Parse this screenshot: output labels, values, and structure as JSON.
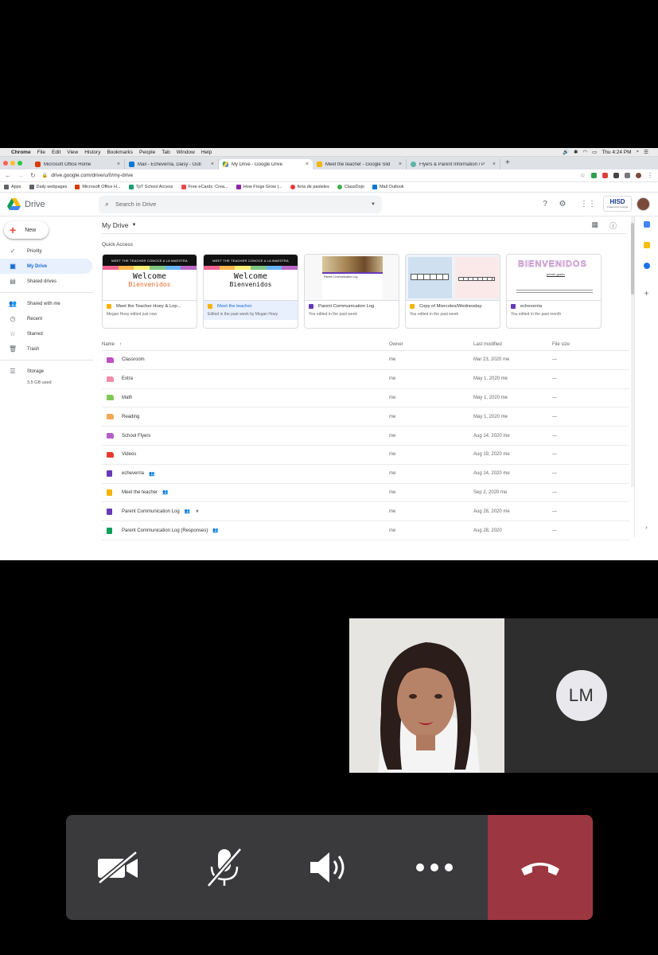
{
  "mac_menu": {
    "items": [
      "Chrome",
      "File",
      "Edit",
      "View",
      "History",
      "Bookmarks",
      "People",
      "Tab",
      "Window",
      "Help"
    ],
    "clock": "Thu 4:24 PM"
  },
  "browser": {
    "tabs": [
      {
        "title": "Microsoft Office Home",
        "color": "#d83b01"
      },
      {
        "title": "Mail - Echeverria, Daisy - Outl",
        "color": "#0078d4"
      },
      {
        "title": "My Drive - Google Drive",
        "color": "#1fa463"
      },
      {
        "title": "Meet the teacher - Google Slid",
        "color": "#f4b400"
      },
      {
        "title": "Flyers & Parent Information / P",
        "color": "#5fb3a6"
      }
    ],
    "url": "drive.google.com/drive/u/0/my-drive",
    "bookmarks": [
      {
        "label": "Apps",
        "color": "#5f6368"
      },
      {
        "label": "Daily webpages",
        "color": "#5f6368"
      },
      {
        "label": "Microsoft Office H...",
        "color": "#d83b01"
      },
      {
        "label": "TpT School Access",
        "color": "#1a9e6e"
      },
      {
        "label": "Free eCards: Crea...",
        "color": "#e94b4b"
      },
      {
        "label": "How Frogs Grow |...",
        "color": "#8e24aa"
      },
      {
        "label": "feria de pasteles",
        "color": "#e53935"
      },
      {
        "label": "ClassDojo",
        "color": "#3fae49"
      },
      {
        "label": "Mail Outlook",
        "color": "#0078d4"
      }
    ]
  },
  "drive": {
    "app_name": "Drive",
    "search_placeholder": "Search in Drive",
    "org_badge": "HISD",
    "org_badge_sub": "Powered by Google",
    "new_label": "New",
    "nav": [
      {
        "label": "Priority",
        "icon": "priority-icon",
        "active": false
      },
      {
        "label": "My Drive",
        "icon": "my-drive-icon",
        "active": true
      },
      {
        "label": "Shared drives",
        "icon": "shared-drives-icon",
        "active": false
      }
    ],
    "nav2": [
      {
        "label": "Shared with me",
        "icon": "shared-with-me-icon"
      },
      {
        "label": "Recent",
        "icon": "clock-icon"
      },
      {
        "label": "Starred",
        "icon": "star-icon"
      },
      {
        "label": "Trash",
        "icon": "trash-icon"
      }
    ],
    "storage_label": "Storage",
    "storage_used": "3.5 GB used",
    "breadcrumb": "My Drive",
    "quick_access_label": "Quick Access",
    "quick_access": [
      {
        "name": "Meet the Teacher Hoey & Lop...",
        "sub": "Megan Hoey edited just now",
        "type": "slides"
      },
      {
        "name": "Meet the teacher",
        "sub": "Edited in the past week by Megan Hoey",
        "type": "slides"
      },
      {
        "name": "Parent Communication Log",
        "sub": "You edited in the past week",
        "type": "forms"
      },
      {
        "name": "Copy of Miercoles/Wednesday",
        "sub": "You edited in the past week",
        "type": "slides"
      },
      {
        "name": "echeverria",
        "sub": "You edited in the past month",
        "type": "forms"
      }
    ],
    "thumb_text": {
      "banner": "MEET THE TEACHER  CONOCE A LA MAESTRA",
      "welcome": "Welcome",
      "bienvenidos": "Bienvenidos",
      "form_title": "Parent Communication Log",
      "bienvenidos_art": "BIENVENIDOS",
      "grado": "primer grado"
    },
    "columns": {
      "name": "Name",
      "owner": "Owner",
      "modified": "Last modified",
      "size": "File size"
    },
    "files": [
      {
        "name": "Classroom",
        "owner": "me",
        "modified": "Mar 23, 2020 me",
        "size": "—",
        "color": "#c04fc2",
        "kind": "folder",
        "shared": false,
        "starred": false
      },
      {
        "name": "Extra",
        "owner": "me",
        "modified": "May 1, 2020 me",
        "size": "—",
        "color": "#f28ba8",
        "kind": "folder",
        "shared": false,
        "starred": false
      },
      {
        "name": "Math",
        "owner": "me",
        "modified": "May 1, 2020 me",
        "size": "—",
        "color": "#7cc956",
        "kind": "folder",
        "shared": false,
        "starred": false
      },
      {
        "name": "Reading",
        "owner": "me",
        "modified": "May 1, 2020 me",
        "size": "—",
        "color": "#f5a855",
        "kind": "folder",
        "shared": false,
        "starred": false
      },
      {
        "name": "School Flyers",
        "owner": "me",
        "modified": "Aug 14, 2020 me",
        "size": "—",
        "color": "#b45ec6",
        "kind": "shared-folder",
        "shared": false,
        "starred": false
      },
      {
        "name": "Videos",
        "owner": "me",
        "modified": "Aug 19, 2020 me",
        "size": "—",
        "color": "#e63a2e",
        "kind": "folder",
        "shared": false,
        "starred": false
      },
      {
        "name": "echeverria",
        "owner": "me",
        "modified": "Aug 14, 2020 me",
        "size": "—",
        "color": "#673ab7",
        "kind": "form",
        "shared": true,
        "starred": false
      },
      {
        "name": "Meet the teacher",
        "owner": "me",
        "modified": "Sep 2, 2020 me",
        "size": "—",
        "color": "#f4b400",
        "kind": "slides",
        "shared": true,
        "starred": false
      },
      {
        "name": "Parent Communication Log",
        "owner": "me",
        "modified": "Aug 28, 2020 me",
        "size": "—",
        "color": "#673ab7",
        "kind": "form",
        "shared": true,
        "starred": true
      },
      {
        "name": "Parent Communication Log (Responses)",
        "owner": "me",
        "modified": "Aug 28, 2020",
        "size": "—",
        "color": "#0f9d58",
        "kind": "sheet",
        "shared": true,
        "starred": false
      }
    ]
  },
  "call": {
    "participant_initials": "LM",
    "controls": [
      "camera-off",
      "mic-muted",
      "speaker",
      "more",
      "end-call"
    ],
    "end_color": "#9c3640"
  }
}
